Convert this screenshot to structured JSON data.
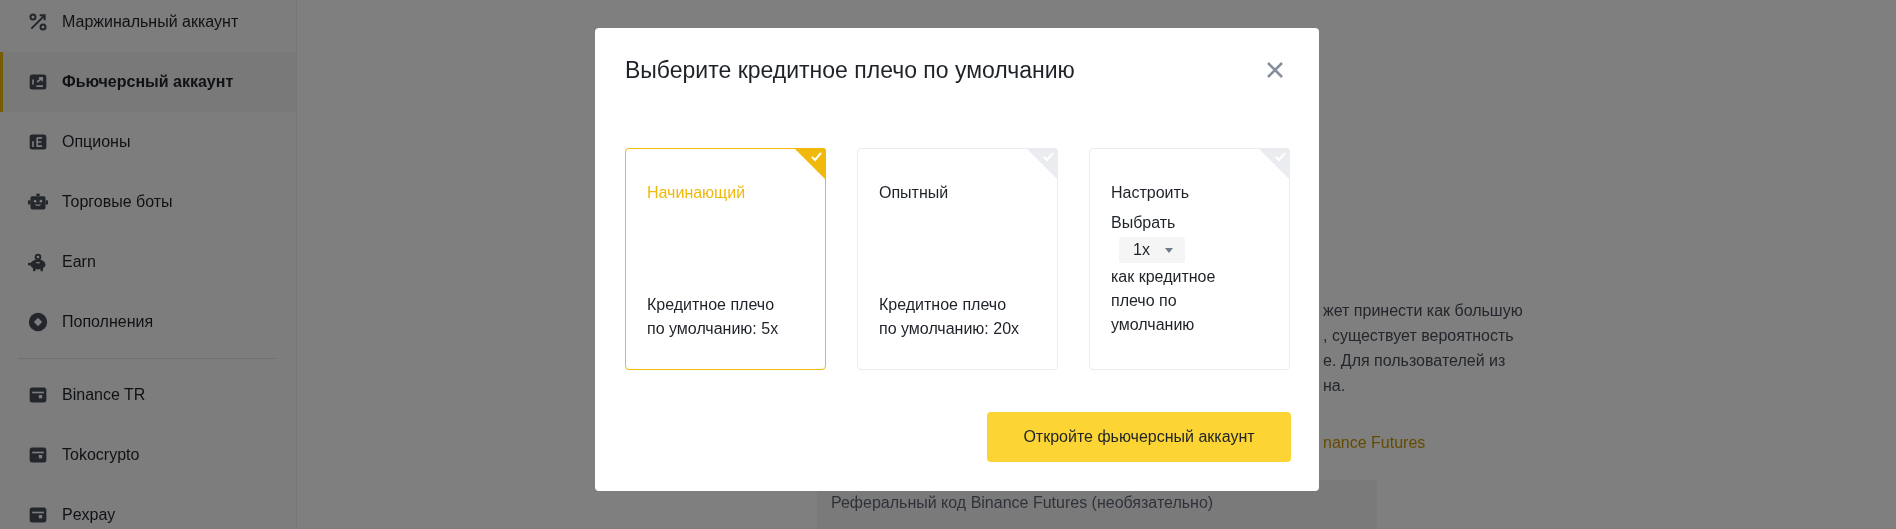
{
  "sidebar": {
    "sections": [
      {
        "items": [
          {
            "label": "Маржинальный аккаунт",
            "selected": false
          },
          {
            "label": "Фьючерсный аккаунт",
            "selected": true
          },
          {
            "label": "Опционы",
            "selected": false
          },
          {
            "label": "Торговые боты",
            "selected": false
          },
          {
            "label": "Earn",
            "selected": false
          },
          {
            "label": "Пополнения",
            "selected": false
          }
        ]
      },
      {
        "items": [
          {
            "label": "Binance TR",
            "selected": false
          },
          {
            "label": "Tokocrypto",
            "selected": false
          },
          {
            "label": "Pexpay",
            "selected": false
          }
        ]
      }
    ]
  },
  "content": {
    "paragraph_lines": [
      "жет принести как большую",
      ", существует вероятность",
      "е. Для пользователей из",
      "на."
    ],
    "link": "nance Futures",
    "referral_field": {
      "placeholder": "Реферальный код Binance Futures (необязательно)"
    }
  },
  "modal": {
    "title": "Выберите кредитное плечо по умолчанию",
    "options": [
      {
        "kind": "preset",
        "name": "Начинающий",
        "description": "Кредитное плечо по умолчанию: 5x",
        "selected": true
      },
      {
        "kind": "preset",
        "name": "Опытный",
        "description": "Кредитное плечо по умолчанию: 20x",
        "selected": false
      },
      {
        "kind": "custom",
        "name": "Настроить",
        "prefix": "Выбрать",
        "leverage": "1x",
        "suffix": "как кредитное плечо по умолчанию",
        "selected": false
      }
    ],
    "button": "Откройте фьючерсный аккаунт"
  }
}
